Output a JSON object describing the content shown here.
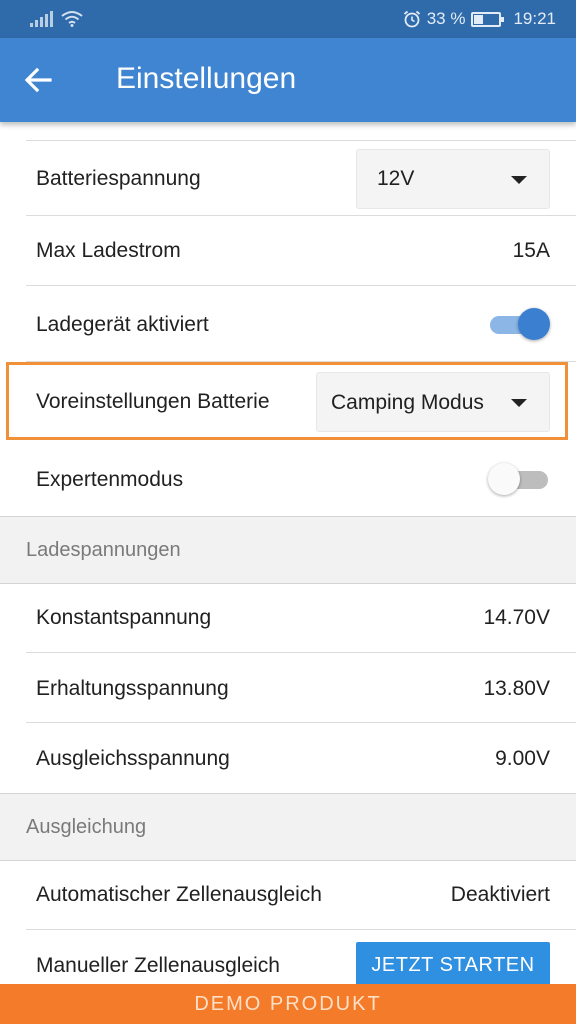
{
  "status_bar": {
    "battery_percent": "33 %",
    "time": "19:21",
    "icons": [
      "signal-icon",
      "wifi-icon",
      "alarm-icon",
      "battery-icon"
    ]
  },
  "app_bar": {
    "title": "Einstellungen",
    "back_icon": "arrow-left-icon"
  },
  "settings": {
    "battery_voltage": {
      "label": "Batteriespannung",
      "selected": "12V"
    },
    "max_charge_current": {
      "label": "Max Ladestrom",
      "value": "15A"
    },
    "charger_enabled": {
      "label": "Ladegerät aktiviert",
      "on": true
    },
    "battery_preset": {
      "label": "Voreinstellungen Batterie",
      "selected": "Camping Modus"
    },
    "expert_mode": {
      "label": "Expertenmodus",
      "on": false
    }
  },
  "charge_voltages": {
    "title": "Ladespannungen",
    "rows": [
      {
        "label": "Konstantspannung",
        "value": "14.70V"
      },
      {
        "label": "Erhaltungsspannung",
        "value": "13.80V"
      },
      {
        "label": "Ausgleichsspannung",
        "value": "9.00V"
      }
    ]
  },
  "balancing": {
    "title": "Ausgleichung",
    "auto": {
      "label": "Automatischer Zellenausgleich",
      "value": "Deaktiviert"
    },
    "manual": {
      "label": "Manueller Zellenausgleich",
      "button": "JETZT STARTEN"
    }
  },
  "footer": {
    "banner": "DEMO PRODUKT"
  },
  "colors": {
    "app_bar": "#3f85d1",
    "status_bar": "#2f6aaa",
    "highlight": "#f0913a",
    "demo_banner": "#f47b2a",
    "toggle_on": "#3a7fd0",
    "button": "#2f8fe0"
  }
}
